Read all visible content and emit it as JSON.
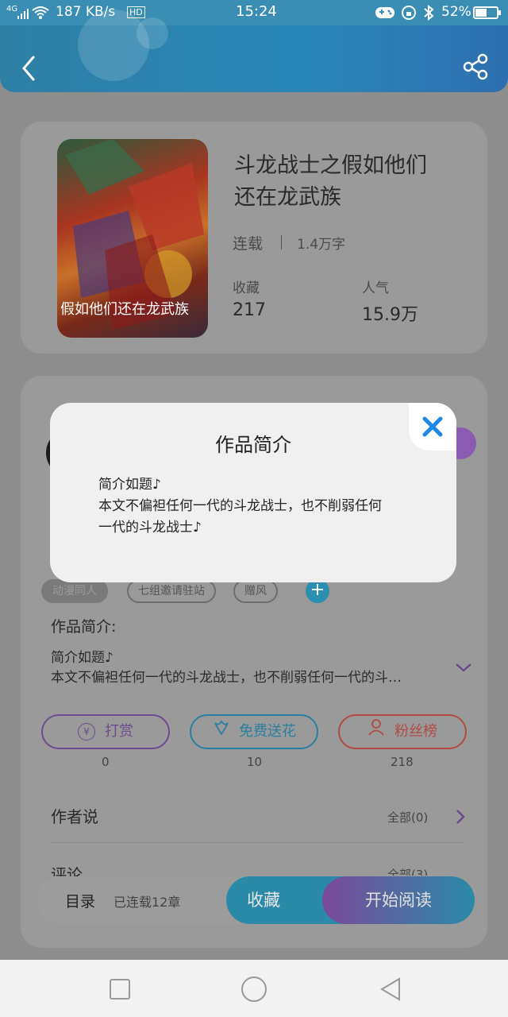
{
  "status": {
    "network": "4G",
    "speed": "187 KB/s",
    "hd": "HD",
    "time": "15:24",
    "battery": "52%"
  },
  "book": {
    "title_line1": "斗龙战士之假如他们",
    "title_line2": "还在龙武族",
    "status": "连载",
    "words": "1.4万字",
    "fav_label": "收藏",
    "fav_value": "217",
    "pop_label": "人气",
    "pop_value": "15.9万",
    "cover_caption": "假如他们还在龙武族"
  },
  "tags": [
    "动漫同人",
    "七组邀请驻站",
    "赠风"
  ],
  "intro": {
    "heading": "作品简介:",
    "line1": "简介如题♪",
    "line2": "本文不偏袒任何一代的斗龙战士，也不削弱任何一代的斗…"
  },
  "actions": [
    {
      "label": "打赏",
      "count": "0",
      "icon": "yen-icon"
    },
    {
      "label": "免费送花",
      "count": "10",
      "icon": "flower-icon"
    },
    {
      "label": "粉丝榜",
      "count": "218",
      "icon": "user-icon"
    }
  ],
  "author_says": {
    "label": "作者说",
    "more": "全部(0)"
  },
  "comments": {
    "label": "评论",
    "more": "全部(3)"
  },
  "bottom": {
    "catalog": "目录",
    "chapters": "已连载12章",
    "fav_button": "收藏",
    "read_button": "开始阅读"
  },
  "modal": {
    "title": "作品简介",
    "line1": "简介如题♪",
    "line2": "本文不偏袒任何一代的斗龙战士，也不削弱任何",
    "line3": "一代的斗龙战士♪"
  },
  "colors": {
    "header": "#2a86b9",
    "accent_purple": "#8a5bb0",
    "accent_teal": "#2a8fb0",
    "accent_red": "#c0504a",
    "close": "#1e88e5"
  }
}
